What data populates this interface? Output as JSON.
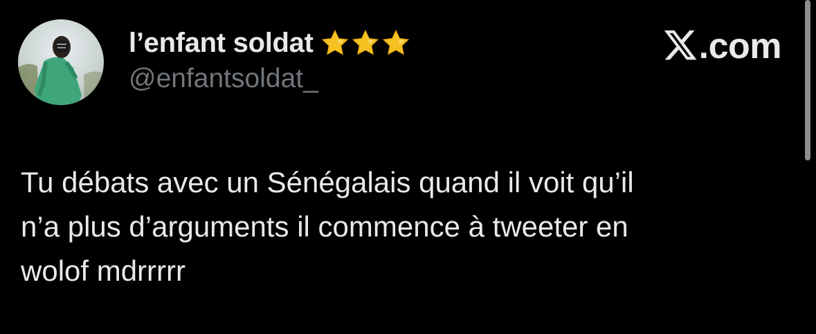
{
  "post": {
    "author": {
      "display_name": "l’enfant soldat",
      "badges": [
        "star-icon",
        "star-icon",
        "star-icon"
      ],
      "handle": "@enfantsoldat_",
      "avatar_icon": "profile-photo"
    },
    "brand": {
      "icon": "x-logo-icon",
      "label": ".com"
    },
    "text": "Tu débats avec un Sénégalais quand il voit qu’il\nn’a plus d’arguments il commence à tweeter en\nwolof mdrrrrr"
  },
  "colors": {
    "background": "#000000",
    "text_primary": "#e7e9ea",
    "text_secondary": "#71767b",
    "star": "#f5c021"
  }
}
